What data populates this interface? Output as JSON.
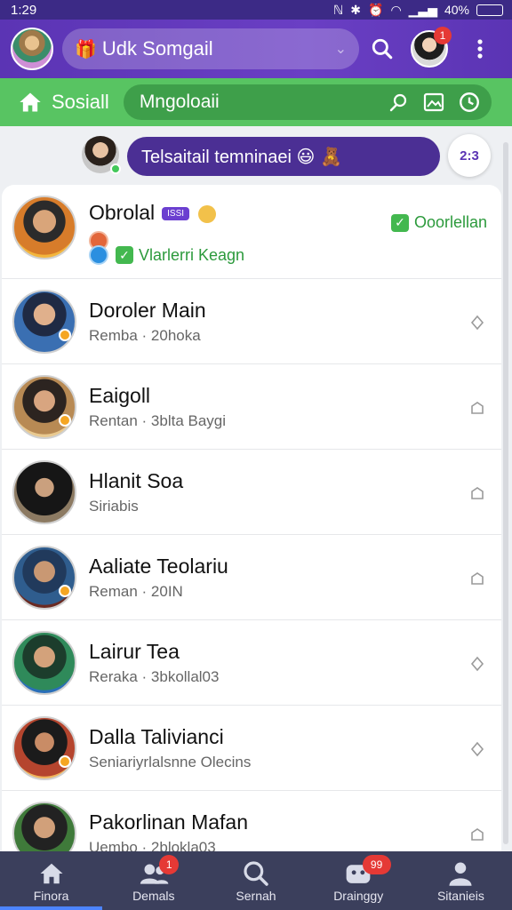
{
  "status_bar": {
    "time": "1:29",
    "battery": "40%"
  },
  "app_bar": {
    "title": "Udk Somgail",
    "notification_count": "1"
  },
  "green_bar": {
    "home_label": "Sosiall",
    "search_text": "Mngoloaii"
  },
  "story_row": {
    "pill_text": "Telsaitail temninaei 😃 🧸",
    "badge_text": "2:3"
  },
  "chats": [
    {
      "name": "Obrolal",
      "tag": "ISSI",
      "status_text": "Ooorlellan",
      "sub": "Vlarlerri Keagn"
    },
    {
      "name": "Doroler Main",
      "sub": "Remba · 20hoka"
    },
    {
      "name": "Eaigoll",
      "sub": "Rentan · 3blta Baygi"
    },
    {
      "name": "Hlanit Soa",
      "sub": "Siriabis"
    },
    {
      "name": "Aaliate Teolariu",
      "sub": "Reman · 20IN"
    },
    {
      "name": "Lairur Tea",
      "sub": "Reraka · 3bkollal03"
    },
    {
      "name": "Dalla Talivianci",
      "sub": "Seniariyrlalsnne Olecins"
    },
    {
      "name": "Pakorlinan Mafan",
      "sub": "Uembo · 2blokla03"
    }
  ],
  "bottom_nav": [
    {
      "label": "Finora",
      "icon": "home-icon"
    },
    {
      "label": "Demals",
      "icon": "people-icon",
      "badge": "1"
    },
    {
      "label": "Sernah",
      "icon": "search-icon"
    },
    {
      "label": "Drainggy",
      "icon": "gamepad-icon",
      "badge": "99"
    },
    {
      "label": "Sitanieis",
      "icon": "person-icon"
    }
  ],
  "colors": {
    "purple": "#5b34b4",
    "green": "#58c462",
    "nav": "#3b3f5c"
  }
}
